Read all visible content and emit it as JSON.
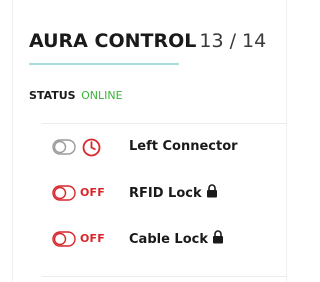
{
  "header": {
    "title": "AURA CONTROL",
    "counter": "13 / 14",
    "accent_color": "#a8dcdc"
  },
  "status": {
    "label": "STATUS",
    "value": "ONLINE",
    "value_color": "#3cb33c"
  },
  "switches": [
    {
      "label": "Left Connector",
      "state": "timer",
      "toggle_icon": "toggle-neutral-icon",
      "indicator_icon": "timer-icon",
      "locked": false
    },
    {
      "label": "RFID Lock",
      "state": "OFF",
      "toggle_icon": "toggle-off-icon",
      "locked": true,
      "lock_icon": "lock-icon"
    },
    {
      "label": "Cable Lock",
      "state": "OFF",
      "toggle_icon": "toggle-off-icon",
      "locked": true,
      "lock_icon": "lock-icon"
    }
  ],
  "colors": {
    "off_red": "#d9262a",
    "neutral_gray": "#9a9a9a",
    "text_dark": "#1a1a1a"
  }
}
